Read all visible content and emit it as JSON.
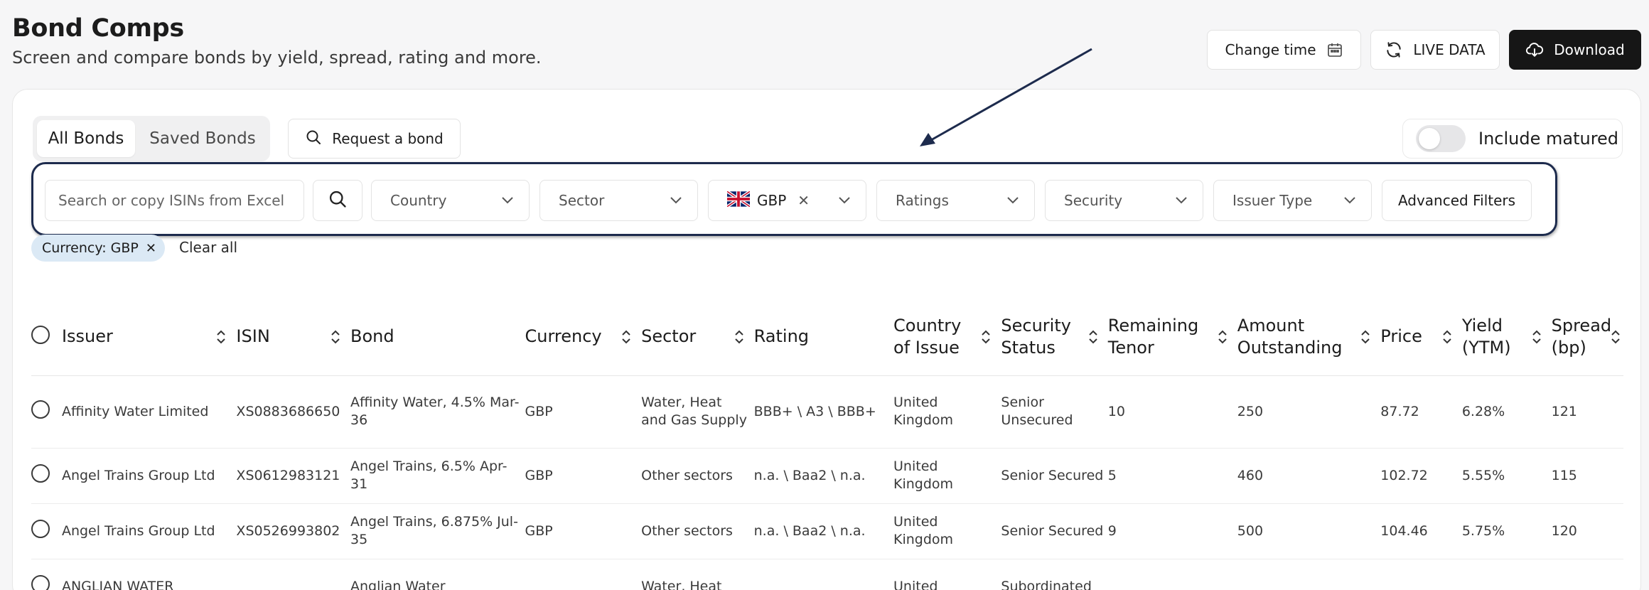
{
  "header": {
    "title": "Bond Comps",
    "subtitle": "Screen and compare bonds by yield, spread, rating and more.",
    "change_time": "Change time",
    "live_data": "LIVE DATA",
    "download": "Download"
  },
  "tabs": {
    "all": "All Bonds",
    "saved": "Saved Bonds",
    "active": "All Bonds"
  },
  "request_bond": "Request a bond",
  "include_matured": {
    "label": "Include matured",
    "on": false
  },
  "filters": {
    "search_placeholder": "Search or copy ISINs from Excel",
    "country": "Country",
    "sector": "Sector",
    "currency": "GBP",
    "ratings": "Ratings",
    "security": "Security",
    "issuer_type": "Issuer Type",
    "advanced": "Advanced Filters"
  },
  "active_filter_chip": "Currency: GBP",
  "clear_all": "Clear all",
  "table": {
    "columns": [
      "Issuer",
      "ISIN",
      "Bond",
      "Currency",
      "Sector",
      "Rating",
      "Country of Issue",
      "Security Status",
      "Remaining Tenor",
      "Amount Outstanding",
      "Price",
      "Yield (YTM)",
      "Spread (bp)"
    ],
    "rows": [
      {
        "issuer": "Affinity Water Limited",
        "isin": "XS0883686650",
        "bond": "Affinity Water, 4.5% Mar-36",
        "currency": "GBP",
        "sector": "Water, Heat and Gas Supply",
        "rating": "BBB+ \\ A3 \\ BBB+",
        "country": "United Kingdom",
        "security": "Senior Unsecured",
        "tenor": "10",
        "amount": "250",
        "price": "87.72",
        "yield": "6.28%",
        "spread": "121"
      },
      {
        "issuer": "Angel Trains Group Ltd",
        "isin": "XS0612983121",
        "bond": "Angel Trains, 6.5% Apr-31",
        "currency": "GBP",
        "sector": "Other sectors",
        "rating": "n.a. \\ Baa2 \\ n.a.",
        "country": "United Kingdom",
        "security": "Senior Secured",
        "tenor": "5",
        "amount": "460",
        "price": "102.72",
        "yield": "5.55%",
        "spread": "115"
      },
      {
        "issuer": "Angel Trains Group Ltd",
        "isin": "XS0526993802",
        "bond": "Angel Trains, 6.875% Jul-35",
        "currency": "GBP",
        "sector": "Other sectors",
        "rating": "n.a. \\ Baa2 \\ n.a.",
        "country": "United Kingdom",
        "security": "Senior Secured",
        "tenor": "9",
        "amount": "500",
        "price": "104.46",
        "yield": "5.75%",
        "spread": "120"
      },
      {
        "issuer": "ANGLIAN WATER",
        "isin": "",
        "bond": "Anglian Water",
        "currency": "",
        "sector": "Water, Heat",
        "rating": "",
        "country": "United",
        "security": "Subordinated",
        "tenor": "",
        "amount": "",
        "price": "",
        "yield": "",
        "spread": ""
      }
    ]
  },
  "colors": {
    "accent_dark": "#161616",
    "chip_bg": "#dbe9f5",
    "highlight_outline": "#1d2b4d",
    "arrow": "#1d2b4d"
  }
}
